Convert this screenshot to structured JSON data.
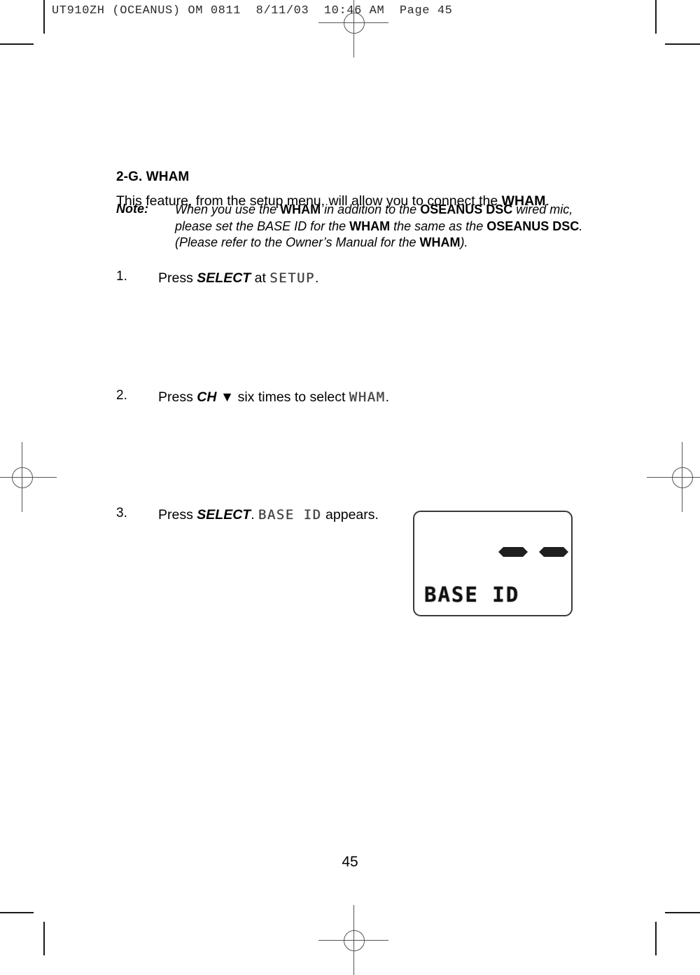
{
  "header": {
    "print_slug": "UT910ZH (OCEANUS) OM 0811  8/11/03  10:46 AM  Page 45"
  },
  "document": {
    "section_heading": "2-G. WHAM",
    "intro_paragraph_html": "This feature, from the setup menu, will allow you to connect the <b>WHAM</b>.",
    "note": {
      "label": "Note:",
      "body_html": "When you use the <b>WHAM</b> in addition to the <b>OSEANUS DSC</b> wired mic, please set the BASE ID for the <b>WHAM</b> the same as the <b>OSEANUS DSC</b>. (Please refer to the Owner&rsquo;s Manual for the <b>WHAM</b>)."
    },
    "steps": [
      {
        "number": "1.",
        "text_html": "Press <i>SELECT</i> at <span class=\"lcdword\">SETUP</span>."
      },
      {
        "number": "2.",
        "text_html": "Press <i>CH</i> &#9660; six times to select <span class=\"lcdword\">WHAM</span>."
      },
      {
        "number": "3.",
        "text_html": "Press <i>SELECT</i>. <span class=\"lcdword\">BASE ID</span> appears."
      }
    ],
    "page_number": "45"
  },
  "lcd_display": {
    "readout_text": "BASE ID",
    "dash_segments": 2
  },
  "colors": {
    "ink": "#000000",
    "paper": "#ffffff",
    "crop_mark": "#1a1a1a",
    "registration_mark": "#555555",
    "lcd_segment": "#1f1f1f"
  }
}
